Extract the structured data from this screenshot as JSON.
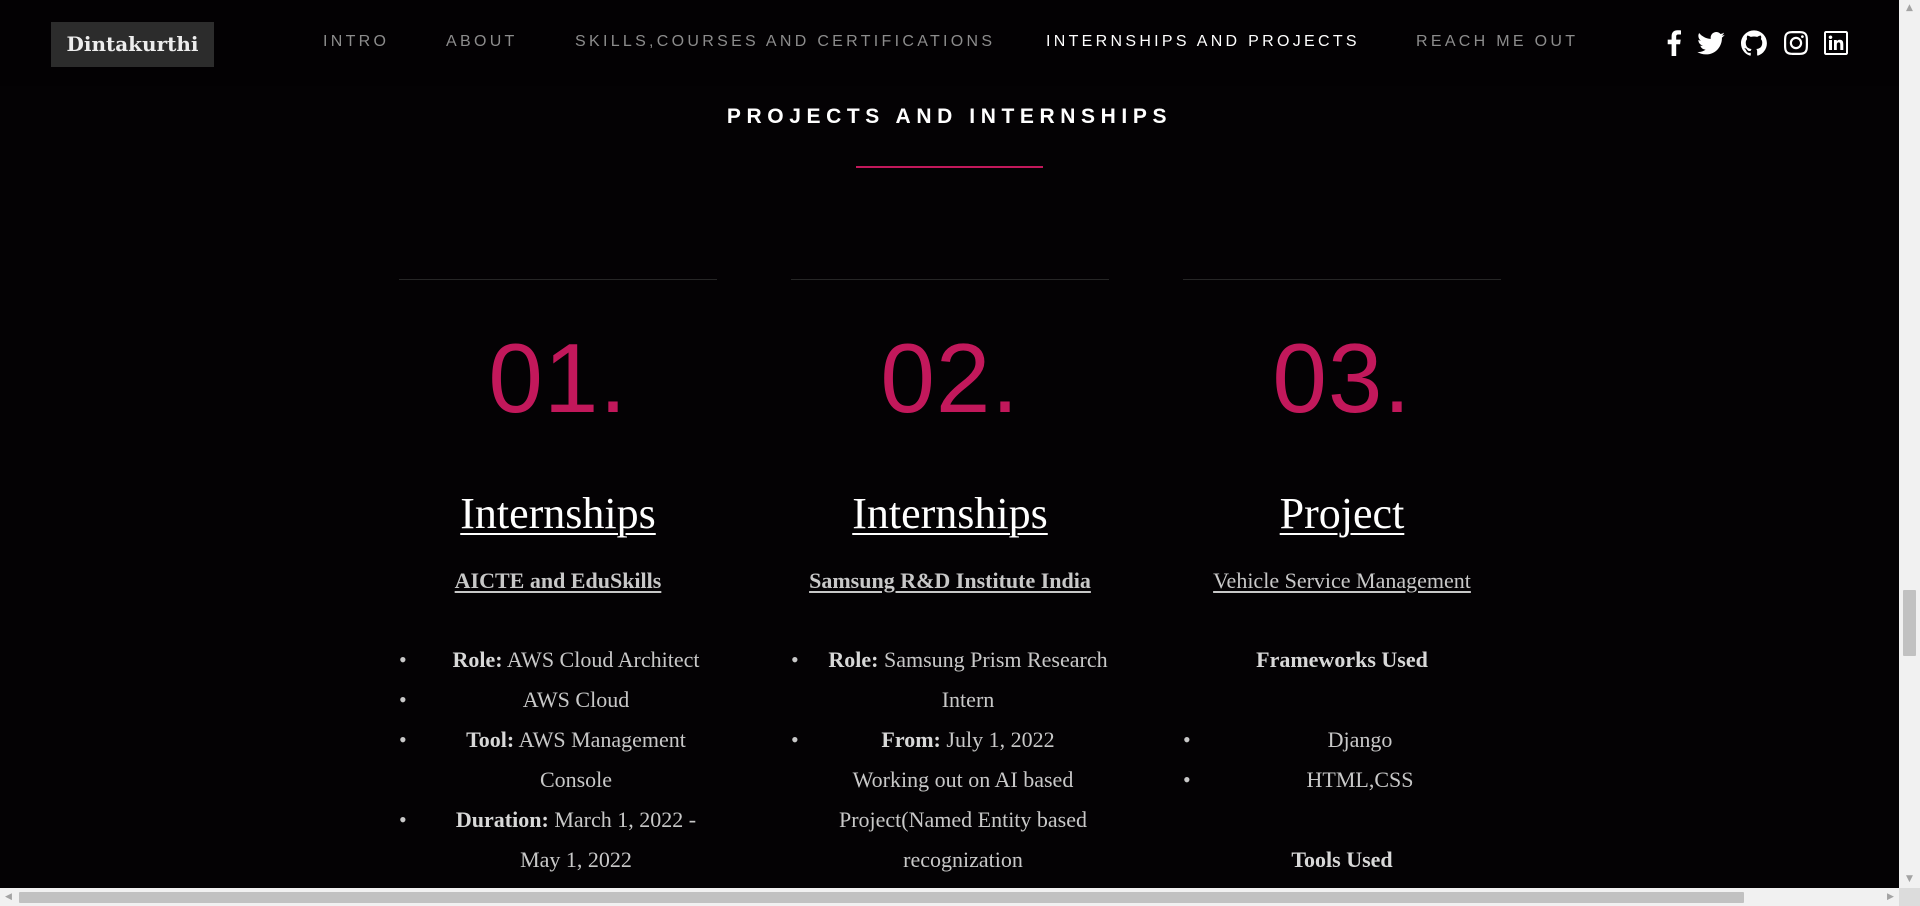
{
  "logo": "Dintakurthi",
  "nav": {
    "items": [
      {
        "label": "INTRO",
        "active": false
      },
      {
        "label": "ABOUT",
        "active": false
      },
      {
        "label": "SKILLS,COURSES AND CERTIFICATIONS",
        "active": false
      },
      {
        "label": "INTERNSHIPS AND PROJECTS",
        "active": true
      },
      {
        "label": "REACH ME OUT",
        "active": false
      }
    ]
  },
  "socials": [
    {
      "icon": "facebook-icon"
    },
    {
      "icon": "twitter-icon"
    },
    {
      "icon": "github-icon"
    },
    {
      "icon": "instagram-icon"
    },
    {
      "icon": "linkedin-icon"
    }
  ],
  "section": {
    "title": "PROJECTS AND INTERNSHIPS",
    "accent_color": "#c2185b"
  },
  "cards": [
    {
      "number": "01.",
      "heading": "Internships",
      "subtitle": "AICTE and EduSkills",
      "items": [
        {
          "label": "Role:",
          "value": "AWS Cloud Architect"
        },
        {
          "label": "",
          "value": "AWS Cloud"
        },
        {
          "label": "Tool:",
          "value": "AWS Management Console"
        },
        {
          "label": "Duration:",
          "value": "March 1, 2022 - May 1, 2022"
        }
      ]
    },
    {
      "number": "02.",
      "heading": "Internships",
      "subtitle": "Samsung R&D Institute India",
      "items": [
        {
          "label": "Role:",
          "value": "Samsung Prism Research Intern"
        },
        {
          "label": "From:",
          "value": "July 1, 2022"
        }
      ],
      "description": "Working out on AI based Project(Named Entity based recognization"
    },
    {
      "number": "03.",
      "heading": "Project",
      "subtitle": "Vehicle Service Management",
      "frameworks_heading": "Frameworks Used",
      "frameworks": [
        "Django",
        "HTML,CSS"
      ],
      "tools_heading": "Tools Used"
    }
  ]
}
